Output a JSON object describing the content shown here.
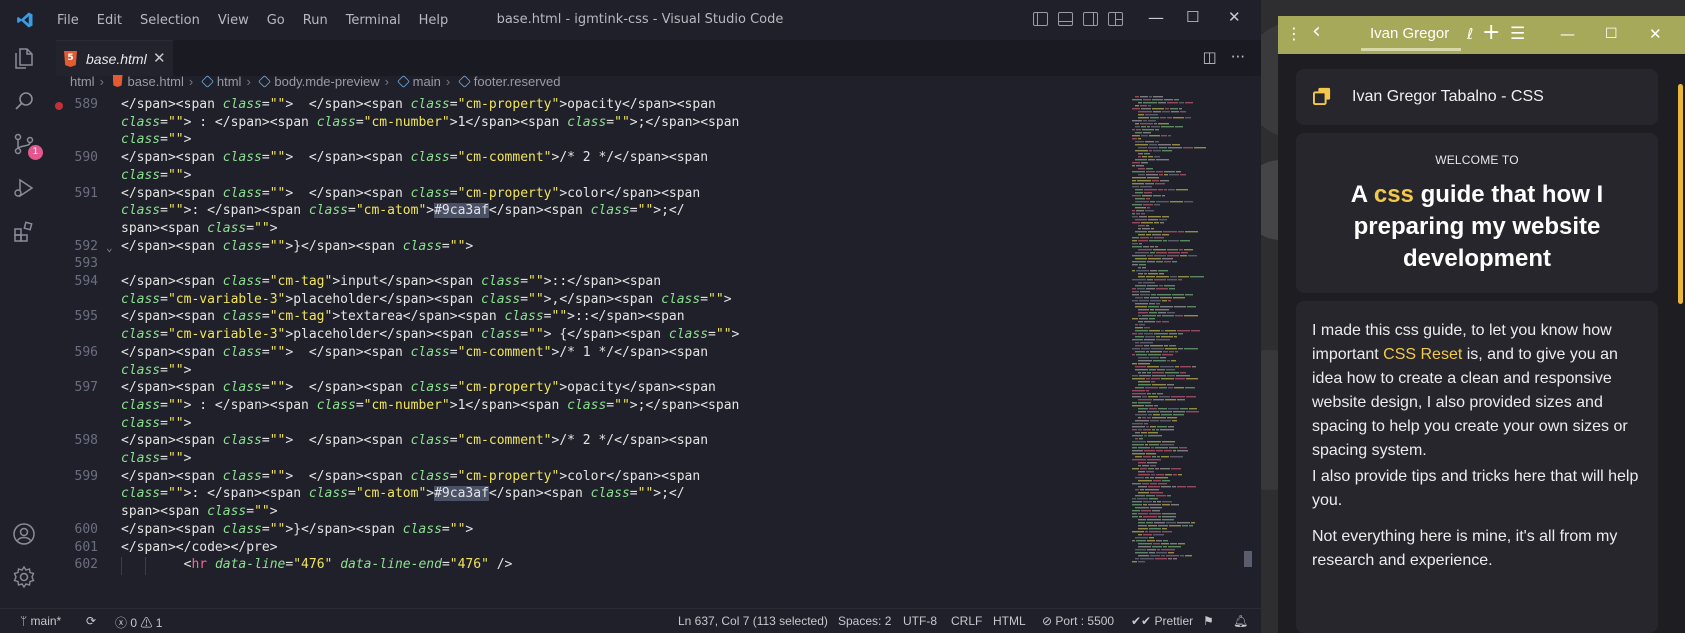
{
  "window": {
    "title": "base.html - igmtink-css - Visual Studio Code",
    "menus": [
      "File",
      "Edit",
      "Selection",
      "View",
      "Go",
      "Run",
      "Terminal",
      "Help"
    ],
    "controls": {
      "minimize": "—",
      "maximize": "☐",
      "close": "✕"
    }
  },
  "activity_bar": {
    "items": [
      "explorer-icon",
      "search-icon",
      "source-control-icon",
      "run-debug-icon",
      "extensions-icon"
    ],
    "scm_badge": "1",
    "bottom": [
      "account-icon",
      "settings-gear-icon"
    ]
  },
  "tabs": [
    {
      "label": "base.html",
      "close": "✕",
      "active": true
    }
  ],
  "tab_actions": {
    "split": "◫",
    "more": "···"
  },
  "breadcrumb": [
    "html",
    "base.html",
    "html",
    "body.mde-preview",
    "main",
    "footer.reserved"
  ],
  "editor": {
    "lines": [
      {
        "num": "589",
        "bp": true,
        "parts": [
          [
            "p",
            "</span><span "
          ],
          [
            "a",
            "class"
          ],
          [
            "p",
            "="
          ],
          [
            "s",
            "\"\""
          ],
          [
            "p",
            ">  </span><span "
          ],
          [
            "a",
            "class"
          ],
          [
            "p",
            "="
          ],
          [
            "s",
            "\"cm-property\""
          ],
          [
            "p",
            ">opacity</span><span"
          ]
        ]
      },
      {
        "num": "",
        "parts": [
          [
            "a",
            "class"
          ],
          [
            "p",
            "="
          ],
          [
            "s",
            "\"\""
          ],
          [
            "p",
            "> : </span><span "
          ],
          [
            "a",
            "class"
          ],
          [
            "p",
            "="
          ],
          [
            "s",
            "\"cm-number\""
          ],
          [
            "p",
            ">1</span><span "
          ],
          [
            "a",
            "class"
          ],
          [
            "p",
            "="
          ],
          [
            "s",
            "\"\""
          ],
          [
            "p",
            ">;</span><span"
          ]
        ]
      },
      {
        "num": "",
        "parts": [
          [
            "a",
            "class"
          ],
          [
            "p",
            "="
          ],
          [
            "s",
            "\"\""
          ],
          [
            "p",
            ">"
          ]
        ]
      },
      {
        "num": "590",
        "parts": [
          [
            "p",
            "</span><span "
          ],
          [
            "a",
            "class"
          ],
          [
            "p",
            "="
          ],
          [
            "s",
            "\"\""
          ],
          [
            "p",
            ">  </span><span "
          ],
          [
            "a",
            "class"
          ],
          [
            "p",
            "="
          ],
          [
            "s",
            "\"cm-comment\""
          ],
          [
            "p",
            ">/* 2 */</span><span"
          ]
        ]
      },
      {
        "num": "",
        "parts": [
          [
            "a",
            "class"
          ],
          [
            "p",
            "="
          ],
          [
            "s",
            "\"\""
          ],
          [
            "p",
            ">"
          ]
        ]
      },
      {
        "num": "591",
        "parts": [
          [
            "p",
            "</span><span "
          ],
          [
            "a",
            "class"
          ],
          [
            "p",
            "="
          ],
          [
            "s",
            "\"\""
          ],
          [
            "p",
            ">  </span><span "
          ],
          [
            "a",
            "class"
          ],
          [
            "p",
            "="
          ],
          [
            "s",
            "\"cm-property\""
          ],
          [
            "p",
            ">color</span><span"
          ]
        ]
      },
      {
        "num": "",
        "parts": [
          [
            "a",
            "class"
          ],
          [
            "p",
            "="
          ],
          [
            "s",
            "\"\""
          ],
          [
            "p",
            ">: </span><span "
          ],
          [
            "a",
            "class"
          ],
          [
            "p",
            "="
          ],
          [
            "s",
            "\"cm-atom\""
          ],
          [
            "p",
            ">"
          ],
          [
            "sel",
            "#9ca3af"
          ],
          [
            "p",
            "</span><span "
          ],
          [
            "a",
            "class"
          ],
          [
            "p",
            "="
          ],
          [
            "s",
            "\"\""
          ],
          [
            "p",
            ">;</"
          ]
        ]
      },
      {
        "num": "",
        "parts": [
          [
            "p",
            "span><span "
          ],
          [
            "a",
            "class"
          ],
          [
            "p",
            "="
          ],
          [
            "s",
            "\"\""
          ],
          [
            "p",
            ">"
          ]
        ]
      },
      {
        "num": "592",
        "fold": true,
        "parts": [
          [
            "p",
            "</span><span "
          ],
          [
            "a",
            "class"
          ],
          [
            "p",
            "="
          ],
          [
            "s",
            "\"\""
          ],
          [
            "p",
            ">}</span><span "
          ],
          [
            "a",
            "class"
          ],
          [
            "p",
            "="
          ],
          [
            "s",
            "\"\""
          ],
          [
            "p",
            ">"
          ]
        ]
      },
      {
        "num": "593",
        "parts": []
      },
      {
        "num": "594",
        "parts": [
          [
            "p",
            "</span><span "
          ],
          [
            "a",
            "class"
          ],
          [
            "p",
            "="
          ],
          [
            "s",
            "\"cm-tag\""
          ],
          [
            "p",
            ">input</span><span "
          ],
          [
            "a",
            "class"
          ],
          [
            "p",
            "="
          ],
          [
            "s",
            "\"\""
          ],
          [
            "p",
            ">::</span><span"
          ]
        ]
      },
      {
        "num": "",
        "parts": [
          [
            "a",
            "class"
          ],
          [
            "p",
            "="
          ],
          [
            "s",
            "\"cm-variable-3\""
          ],
          [
            "p",
            ">placeholder</span><span "
          ],
          [
            "a",
            "class"
          ],
          [
            "p",
            "="
          ],
          [
            "s",
            "\"\""
          ],
          [
            "p",
            ">,</span><span "
          ],
          [
            "a",
            "class"
          ],
          [
            "p",
            "="
          ],
          [
            "s",
            "\"\""
          ],
          [
            "p",
            ">"
          ]
        ]
      },
      {
        "num": "595",
        "parts": [
          [
            "p",
            "</span><span "
          ],
          [
            "a",
            "class"
          ],
          [
            "p",
            "="
          ],
          [
            "s",
            "\"cm-tag\""
          ],
          [
            "p",
            ">textarea</span><span "
          ],
          [
            "a",
            "class"
          ],
          [
            "p",
            "="
          ],
          [
            "s",
            "\"\""
          ],
          [
            "p",
            ">::</span><span"
          ]
        ]
      },
      {
        "num": "",
        "parts": [
          [
            "a",
            "class"
          ],
          [
            "p",
            "="
          ],
          [
            "s",
            "\"cm-variable-3\""
          ],
          [
            "p",
            ">placeholder</span><span "
          ],
          [
            "a",
            "class"
          ],
          [
            "p",
            "="
          ],
          [
            "s",
            "\"\""
          ],
          [
            "p",
            "> {</span><span "
          ],
          [
            "a",
            "class"
          ],
          [
            "p",
            "="
          ],
          [
            "s",
            "\"\""
          ],
          [
            "p",
            ">"
          ]
        ]
      },
      {
        "num": "596",
        "parts": [
          [
            "p",
            "</span><span "
          ],
          [
            "a",
            "class"
          ],
          [
            "p",
            "="
          ],
          [
            "s",
            "\"\""
          ],
          [
            "p",
            ">  </span><span "
          ],
          [
            "a",
            "class"
          ],
          [
            "p",
            "="
          ],
          [
            "s",
            "\"cm-comment\""
          ],
          [
            "p",
            ">/* 1 */</span><span"
          ]
        ]
      },
      {
        "num": "",
        "parts": [
          [
            "a",
            "class"
          ],
          [
            "p",
            "="
          ],
          [
            "s",
            "\"\""
          ],
          [
            "p",
            ">"
          ]
        ]
      },
      {
        "num": "597",
        "parts": [
          [
            "p",
            "</span><span "
          ],
          [
            "a",
            "class"
          ],
          [
            "p",
            "="
          ],
          [
            "s",
            "\"\""
          ],
          [
            "p",
            ">  </span><span "
          ],
          [
            "a",
            "class"
          ],
          [
            "p",
            "="
          ],
          [
            "s",
            "\"cm-property\""
          ],
          [
            "p",
            ">opacity</span><span"
          ]
        ]
      },
      {
        "num": "",
        "parts": [
          [
            "a",
            "class"
          ],
          [
            "p",
            "="
          ],
          [
            "s",
            "\"\""
          ],
          [
            "p",
            "> : </span><span "
          ],
          [
            "a",
            "class"
          ],
          [
            "p",
            "="
          ],
          [
            "s",
            "\"cm-number\""
          ],
          [
            "p",
            ">1</span><span "
          ],
          [
            "a",
            "class"
          ],
          [
            "p",
            "="
          ],
          [
            "s",
            "\"\""
          ],
          [
            "p",
            ">;</span><span"
          ]
        ]
      },
      {
        "num": "",
        "parts": [
          [
            "a",
            "class"
          ],
          [
            "p",
            "="
          ],
          [
            "s",
            "\"\""
          ],
          [
            "p",
            ">"
          ]
        ]
      },
      {
        "num": "598",
        "parts": [
          [
            "p",
            "</span><span "
          ],
          [
            "a",
            "class"
          ],
          [
            "p",
            "="
          ],
          [
            "s",
            "\"\""
          ],
          [
            "p",
            ">  </span><span "
          ],
          [
            "a",
            "class"
          ],
          [
            "p",
            "="
          ],
          [
            "s",
            "\"cm-comment\""
          ],
          [
            "p",
            ">/* 2 */</span><span"
          ]
        ]
      },
      {
        "num": "",
        "parts": [
          [
            "a",
            "class"
          ],
          [
            "p",
            "="
          ],
          [
            "s",
            "\"\""
          ],
          [
            "p",
            ">"
          ]
        ]
      },
      {
        "num": "599",
        "parts": [
          [
            "p",
            "</span><span "
          ],
          [
            "a",
            "class"
          ],
          [
            "p",
            "="
          ],
          [
            "s",
            "\"\""
          ],
          [
            "p",
            ">  </span><span "
          ],
          [
            "a",
            "class"
          ],
          [
            "p",
            "="
          ],
          [
            "s",
            "\"cm-property\""
          ],
          [
            "p",
            ">color</span><span"
          ]
        ]
      },
      {
        "num": "",
        "parts": [
          [
            "a",
            "class"
          ],
          [
            "p",
            "="
          ],
          [
            "s",
            "\"\""
          ],
          [
            "p",
            ">: </span><span "
          ],
          [
            "a",
            "class"
          ],
          [
            "p",
            "="
          ],
          [
            "s",
            "\"cm-atom\""
          ],
          [
            "p",
            ">"
          ],
          [
            "sel",
            "#9ca3af"
          ],
          [
            "p",
            "</span><span "
          ],
          [
            "a",
            "class"
          ],
          [
            "p",
            "="
          ],
          [
            "s",
            "\"\""
          ],
          [
            "p",
            ">;</"
          ]
        ]
      },
      {
        "num": "",
        "parts": [
          [
            "p",
            "span><span "
          ],
          [
            "a",
            "class"
          ],
          [
            "p",
            "="
          ],
          [
            "s",
            "\"\""
          ],
          [
            "p",
            ">"
          ]
        ]
      },
      {
        "num": "600",
        "parts": [
          [
            "p",
            "</span><span "
          ],
          [
            "a",
            "class"
          ],
          [
            "p",
            "="
          ],
          [
            "s",
            "\"\""
          ],
          [
            "p",
            ">}</span><span "
          ],
          [
            "a",
            "class"
          ],
          [
            "p",
            "="
          ],
          [
            "s",
            "\"\""
          ],
          [
            "p",
            ">"
          ]
        ]
      },
      {
        "num": "601",
        "parts": [
          [
            "p",
            "</span></code></pre>"
          ]
        ]
      },
      {
        "num": "602",
        "indent": true,
        "parts": [
          [
            "p",
            "        <"
          ],
          [
            "t",
            "hr"
          ],
          [
            "p",
            " "
          ],
          [
            "a",
            "data-line"
          ],
          [
            "p",
            "="
          ],
          [
            "s",
            "\"476\""
          ],
          [
            "p",
            " "
          ],
          [
            "a",
            "data-line-end"
          ],
          [
            "p",
            "="
          ],
          [
            "s",
            "\"476\""
          ],
          [
            "p",
            " />"
          ]
        ]
      }
    ]
  },
  "statusbar": {
    "branch": "main*",
    "sync": "⟳",
    "errors": "0",
    "warnings": "1",
    "position": "Ln 637, Col 7 (113 selected)",
    "spaces": "Spaces: 2",
    "encoding": "UTF-8",
    "eol": "CRLF",
    "language": "HTML",
    "port": "Port : 5500",
    "formatter": "Prettier"
  },
  "preview": {
    "tab_title": "Ivan Gregor",
    "site_title": "Ivan Gregor Tabalno - CSS",
    "welcome": "WELCOME TO",
    "headline_pre": "A ",
    "headline_hl": "css",
    "headline_post": " guide that how I preparing my website development",
    "p1_pre": "I made this css guide, to let you know how important ",
    "p1_link": "CSS Reset",
    "p1_post": " is, and to give you an idea how to create a clean and responsive website design, I also provided sizes and spacing to help you create your own sizes or spacing system.",
    "p2": "I also provide tips and tricks here that will help you.",
    "p3": "Not everything here is mine, it's all from my research and experience."
  },
  "colors": {
    "accent_yellow": "#f2c94c",
    "preview_toolbar": "#a7a95a",
    "tag": "#f76a8c",
    "attr": "#8be08f",
    "string": "#f1e45c"
  }
}
